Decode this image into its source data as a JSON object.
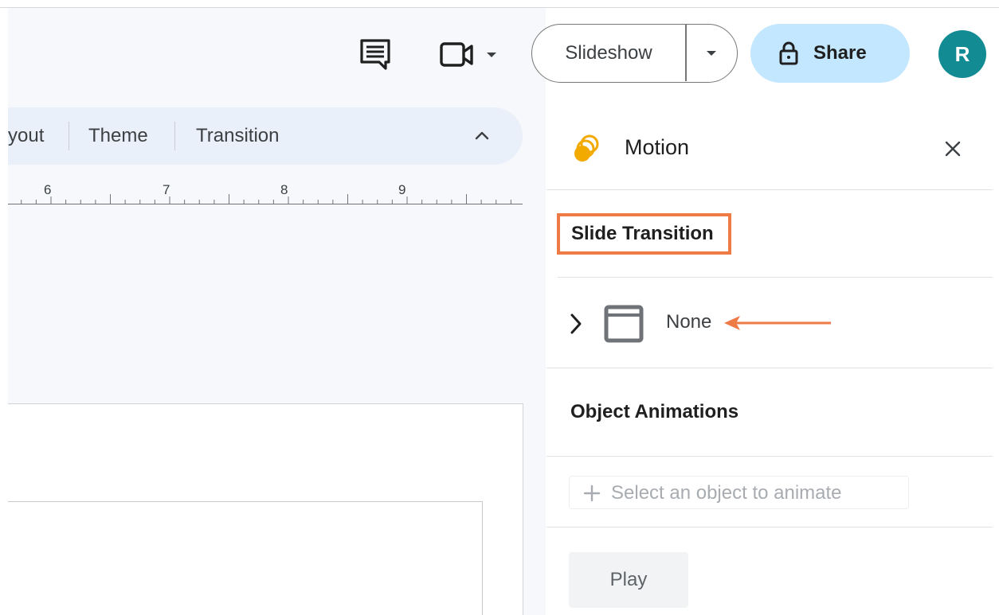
{
  "header": {
    "comment_icon": "comment-icon",
    "meet_icon": "video-camera-icon",
    "slideshow_label": "Slideshow",
    "share_label": "Share",
    "avatar_initial": "R"
  },
  "toolbar": {
    "items": [
      {
        "label": "yout"
      },
      {
        "label": "Theme"
      },
      {
        "label": "Transition"
      }
    ],
    "collapse_icon": "chevron-up-icon"
  },
  "ruler": {
    "labels": [
      "6",
      "7",
      "8",
      "9"
    ]
  },
  "motion_panel": {
    "title": "Motion",
    "close_icon": "close-icon",
    "slide_transition_heading": "Slide Transition",
    "transition_value": "None",
    "object_animations_heading": "Object Animations",
    "select_object_label": "Select an object to animate",
    "play_label": "Play"
  },
  "colors": {
    "accent_orange": "#ee7a46",
    "share_bg": "#c2e7ff",
    "avatar_bg": "#128b93",
    "motion_icon": "#f2a900"
  }
}
